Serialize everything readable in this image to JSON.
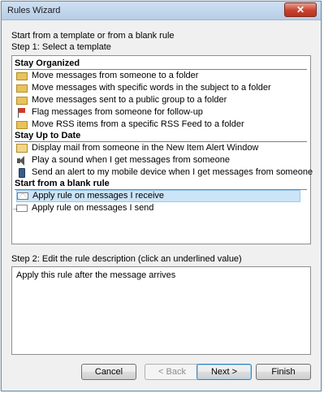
{
  "window": {
    "title": "Rules Wizard",
    "close_label": "✕"
  },
  "intro": "Start from a template or from a blank rule",
  "step1_label": "Step 1: Select a template",
  "groups": [
    {
      "header": "Stay Organized",
      "items": [
        {
          "label": "Move messages from someone to a folder",
          "icon": "folder-icon"
        },
        {
          "label": "Move messages with specific words in the subject to a folder",
          "icon": "folder-icon"
        },
        {
          "label": "Move messages sent to a public group to a folder",
          "icon": "folder-icon"
        },
        {
          "label": "Flag messages from someone for follow-up",
          "icon": "flag-icon"
        },
        {
          "label": "Move RSS items from a specific RSS Feed to a folder",
          "icon": "folder-icon"
        }
      ]
    },
    {
      "header": "Stay Up to Date",
      "items": [
        {
          "label": "Display mail from someone in the New Item Alert Window",
          "icon": "alert-window-icon"
        },
        {
          "label": "Play a sound when I get messages from someone",
          "icon": "speaker-icon"
        },
        {
          "label": "Send an alert to my mobile device when I get messages from someone",
          "icon": "mobile-phone-icon"
        }
      ]
    },
    {
      "header": "Start from a blank rule",
      "items": [
        {
          "label": "Apply rule on messages I receive",
          "icon": "envelope-icon",
          "selected": true
        },
        {
          "label": "Apply rule on messages I send",
          "icon": "send-envelope-icon"
        }
      ]
    }
  ],
  "step2_label": "Step 2: Edit the rule description (click an underlined value)",
  "description": "Apply this rule after the message arrives",
  "buttons": {
    "cancel": "Cancel",
    "back": "< Back",
    "next": "Next >",
    "finish": "Finish"
  }
}
